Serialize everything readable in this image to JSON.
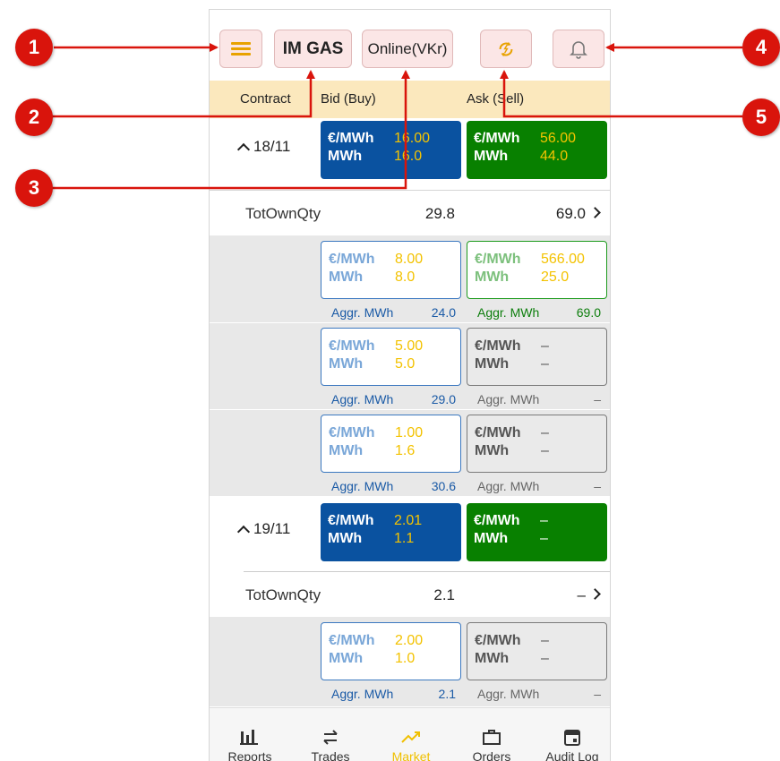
{
  "topbar": {
    "market_label": "IM GAS",
    "status_label": "Online(VKr)"
  },
  "header": {
    "contract": "Contract",
    "bid": "Bid (Buy)",
    "ask": "Ask (Sell)"
  },
  "labels": {
    "price_unit": "€/MWh",
    "qty_unit": "MWh",
    "aggr": "Aggr. MWh",
    "tot": "TotOwnQty"
  },
  "contracts": [
    {
      "date": "18/11",
      "best_bid": {
        "price": "16.00",
        "qty": "16.0"
      },
      "best_ask": {
        "price": "56.00",
        "qty": "44.0"
      },
      "tot_bid": "29.8",
      "tot_ask": "69.0",
      "depth": [
        {
          "bid_price": "8.00",
          "bid_qty": "8.0",
          "bid_aggr": "24.0",
          "ask_price": "566.00",
          "ask_qty": "25.0",
          "ask_aggr": "69.0"
        },
        {
          "bid_price": "5.00",
          "bid_qty": "5.0",
          "bid_aggr": "29.0",
          "ask_price": "–",
          "ask_qty": "–",
          "ask_aggr": "–"
        },
        {
          "bid_price": "1.00",
          "bid_qty": "1.6",
          "bid_aggr": "30.6",
          "ask_price": "–",
          "ask_qty": "–",
          "ask_aggr": "–"
        }
      ]
    },
    {
      "date": "19/11",
      "best_bid": {
        "price": "2.01",
        "qty": "1.1"
      },
      "best_ask": {
        "price": "–",
        "qty": "–"
      },
      "tot_bid": "2.1",
      "tot_ask": "–",
      "depth": [
        {
          "bid_price": "2.00",
          "bid_qty": "1.0",
          "bid_aggr": "2.1",
          "ask_price": "–",
          "ask_qty": "–",
          "ask_aggr": "–"
        }
      ]
    }
  ],
  "nav": {
    "items": [
      "Reports",
      "Trades",
      "Market",
      "Orders",
      "Audit Log"
    ],
    "active": "Market"
  },
  "callouts": [
    "1",
    "2",
    "3",
    "4",
    "5"
  ],
  "colors": {
    "bid": "#0a52a0",
    "ask": "#088000",
    "value": "#f5c400",
    "callout": "#d9140c",
    "header": "#fbe8bd",
    "topbutton": "#fbe6e6"
  }
}
